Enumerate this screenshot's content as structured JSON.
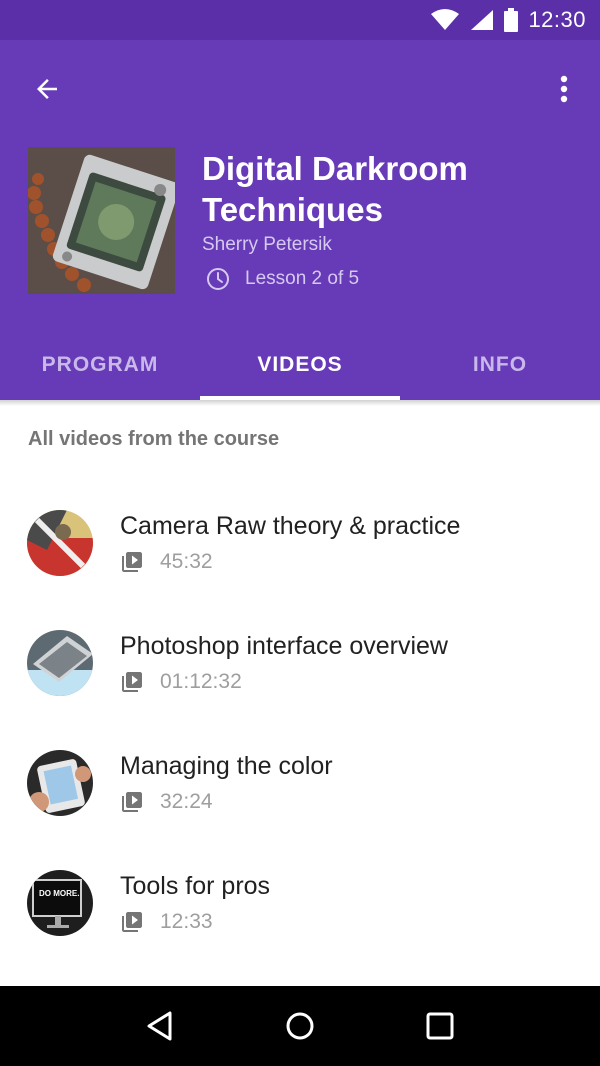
{
  "status_bar": {
    "time": "12:30",
    "icons": [
      "wifi-icon",
      "signal-icon",
      "battery-icon"
    ]
  },
  "header": {
    "back_icon": "arrow-back-icon",
    "more_icon": "more-vert-icon",
    "course_title": "Digital Darkroom Techniques",
    "author": "Sherry Petersik",
    "lesson_progress": "Lesson 2 of 5",
    "lesson_icon": "clock-icon"
  },
  "tabs": [
    {
      "label": "PROGRAM",
      "active": false
    },
    {
      "label": "VIDEOS",
      "active": true
    },
    {
      "label": "INFO",
      "active": false
    }
  ],
  "section_heading": "All videos from the course",
  "videos": [
    {
      "title": "Camera Raw theory & practice",
      "duration": "45:32"
    },
    {
      "title": "Photoshop interface overview",
      "duration": "01:12:32"
    },
    {
      "title": "Managing the color",
      "duration": "32:24"
    },
    {
      "title": "Tools for pros",
      "duration": "12:33"
    }
  ],
  "thumbnail_text": {
    "tools_for_pros": "DO MORE."
  },
  "nav_bar": {
    "icons": [
      "back-triangle-icon",
      "home-circle-icon",
      "recents-square-icon"
    ]
  },
  "colors": {
    "primary": "#673ab7",
    "primary_dark": "#5a2fa8",
    "tab_indicator": "#ffffff"
  }
}
